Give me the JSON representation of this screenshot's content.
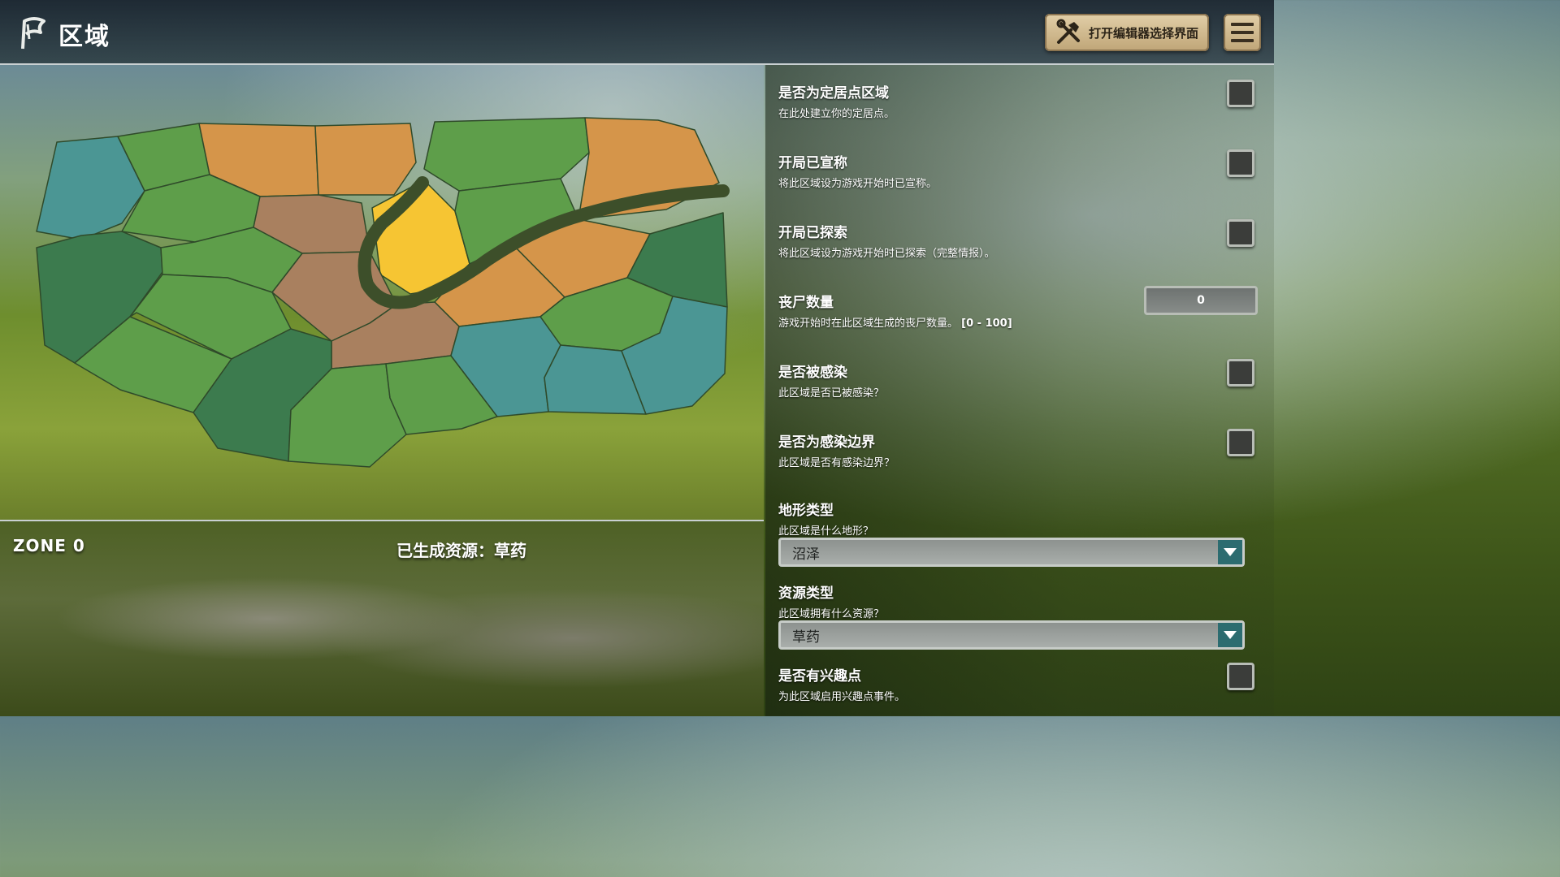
{
  "header": {
    "title": "区域",
    "editor_button_label": "打开编辑器选择界面"
  },
  "map": {
    "colors": {
      "teal": "#4b9694",
      "green": "#5e9e4a",
      "dark_green": "#3c7b4e",
      "orange": "#d5954a",
      "brown": "#a9805f",
      "selected": "#f6c533",
      "road": "#3d4f2a"
    },
    "legend_note": ""
  },
  "info": {
    "zone_name": "ZONE 0",
    "resource_label": "已生成资源：草药"
  },
  "settings": {
    "settlement": {
      "title": "是否为定居点区域",
      "desc": "在此处建立你的定居点。"
    },
    "claimed": {
      "title": "开局已宣称",
      "desc": "将此区域设为游戏开始时已宣称。"
    },
    "explored": {
      "title": "开局已探索",
      "desc": "将此区域设为游戏开始时已探索（完整情报）。"
    },
    "zombies": {
      "title": "丧尸数量",
      "desc": "游戏开始时在此区域生成的丧尸数量。",
      "range": "[0 - 100]",
      "value": "0"
    },
    "infected": {
      "title": "是否被感染",
      "desc": "此区域是否已被感染？"
    },
    "infected_border": {
      "title": "是否为感染边界",
      "desc": "此区域是否有感染边界？"
    },
    "terrain": {
      "title": "地形类型",
      "desc": "此区域是什么地形？",
      "selected": "沼泽"
    },
    "resource": {
      "title": "资源类型",
      "desc": "此区域拥有什么资源？",
      "selected": "草药"
    },
    "poi": {
      "title": "是否有兴趣点",
      "desc": "为此区域启用兴趣点事件。"
    }
  }
}
